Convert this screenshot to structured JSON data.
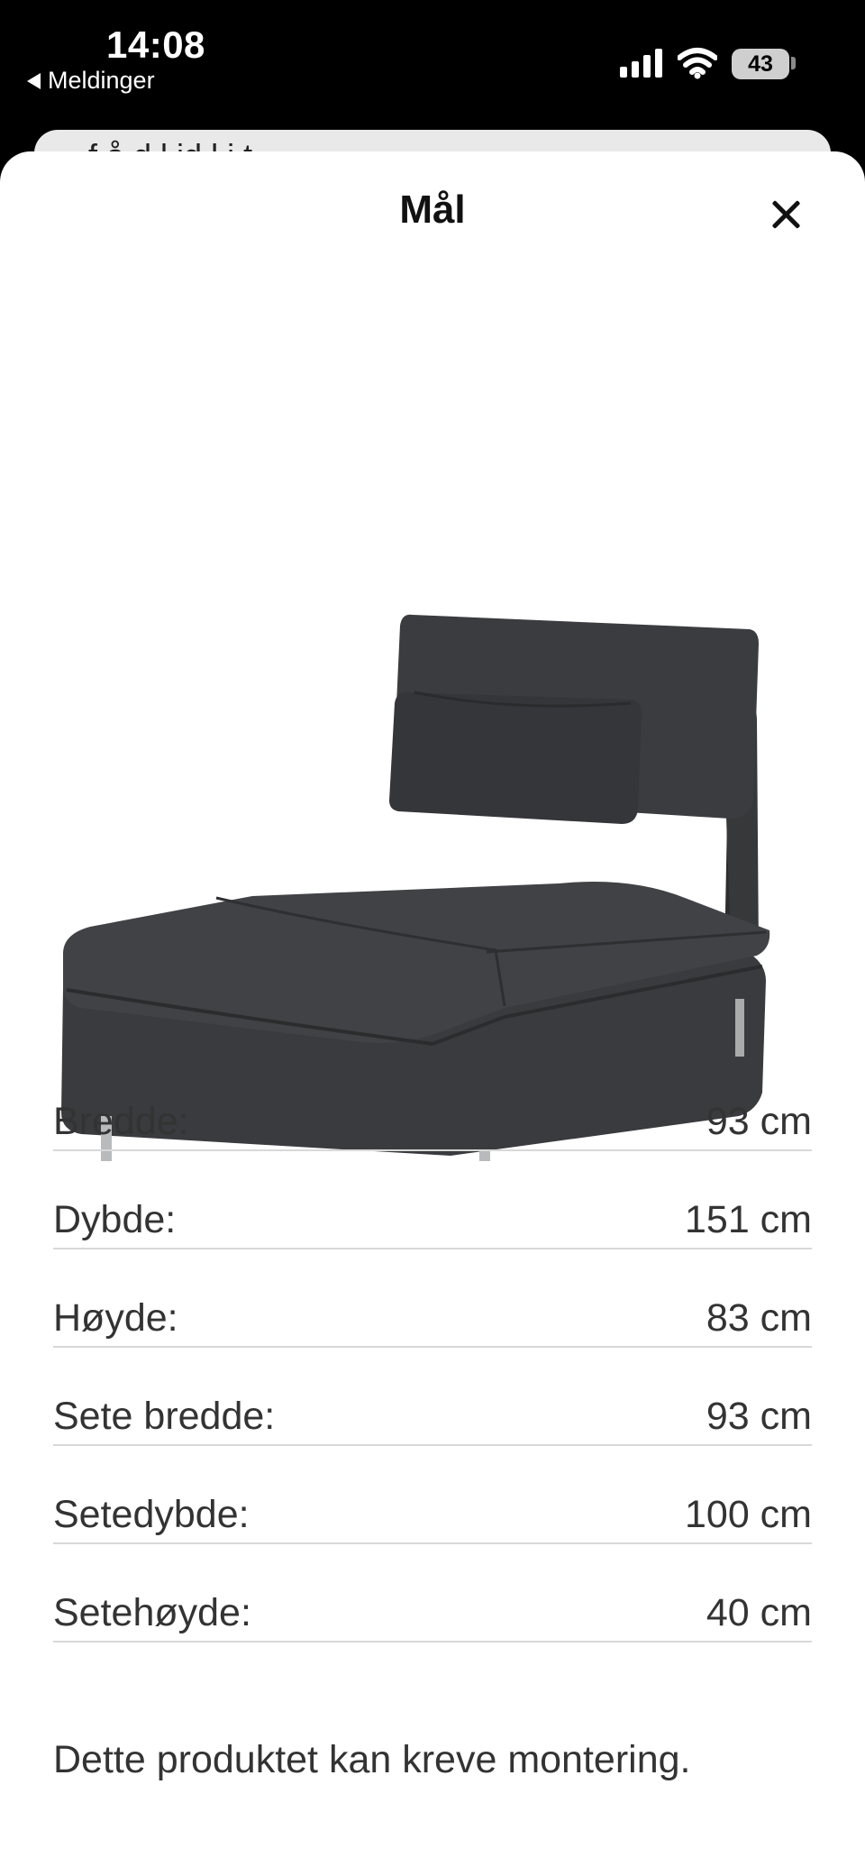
{
  "status_bar": {
    "time": "14:08",
    "back_label": "Meldinger",
    "battery": "43"
  },
  "under_sheet": {
    "partial_text": "f    å    d  l  id  l i    t"
  },
  "sheet": {
    "title": "Mål",
    "close_icon": "close-icon",
    "image_subject": "sofa-chaise-image"
  },
  "specs": [
    {
      "label": "Bredde:",
      "value": "93 cm"
    },
    {
      "label": "Dybde:",
      "value": "151 cm"
    },
    {
      "label": "Høyde:",
      "value": "83 cm"
    },
    {
      "label": "Sete bredde:",
      "value": "93 cm"
    },
    {
      "label": "Setedybde:",
      "value": "100 cm"
    },
    {
      "label": "Setehøyde:",
      "value": "40 cm"
    }
  ],
  "note": "Dette produktet kan kreve montering.",
  "colors": {
    "status_bg": "#000000",
    "sheet_bg": "#ffffff",
    "text": "#333333",
    "divider": "#d8d8d8",
    "sofa": "#3a3b3d"
  }
}
